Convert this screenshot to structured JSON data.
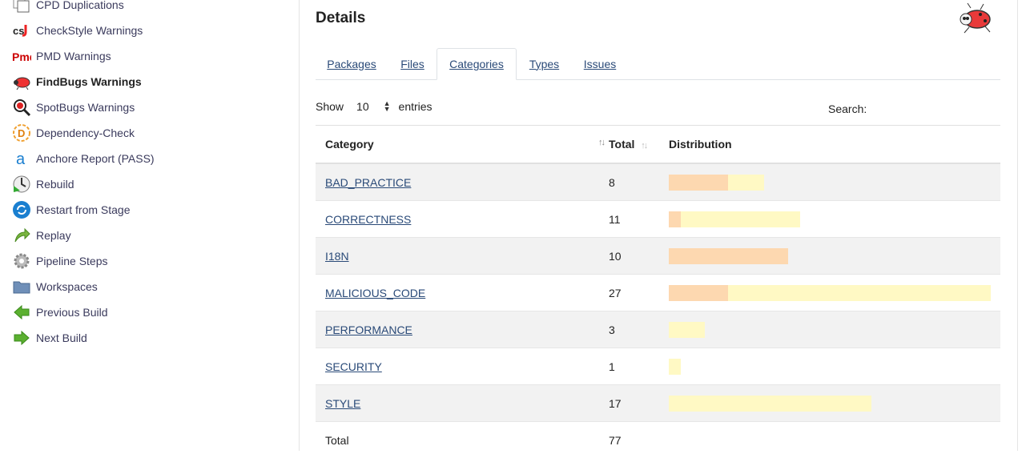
{
  "sidebar": {
    "items": [
      {
        "label": "CPD Duplications",
        "icon": "cpd-icon"
      },
      {
        "label": "CheckStyle Warnings",
        "icon": "checkstyle-icon"
      },
      {
        "label": "PMD Warnings",
        "icon": "pmd-icon"
      },
      {
        "label": "FindBugs Warnings",
        "icon": "findbugs-icon",
        "active": true
      },
      {
        "label": "SpotBugs Warnings",
        "icon": "spotbugs-icon"
      },
      {
        "label": "Dependency-Check",
        "icon": "dependency-check-icon"
      },
      {
        "label": "Anchore Report (PASS)",
        "icon": "anchore-icon"
      },
      {
        "label": "Rebuild",
        "icon": "rebuild-icon"
      },
      {
        "label": "Restart from Stage",
        "icon": "restart-icon"
      },
      {
        "label": "Replay",
        "icon": "replay-icon"
      },
      {
        "label": "Pipeline Steps",
        "icon": "gear-icon"
      },
      {
        "label": "Workspaces",
        "icon": "folder-icon"
      },
      {
        "label": "Previous Build",
        "icon": "arrow-left-icon"
      },
      {
        "label": "Next Build",
        "icon": "arrow-right-icon"
      }
    ]
  },
  "main": {
    "title": "Details",
    "tabs": [
      "Packages",
      "Files",
      "Categories",
      "Types",
      "Issues"
    ],
    "active_tab": "Categories",
    "show_label": "Show",
    "entries_value": "10",
    "entries_label": "entries",
    "search_label": "Search:",
    "table": {
      "headers": {
        "category": "Category",
        "total": "Total",
        "distribution": "Distribution"
      },
      "rows": [
        {
          "category": "BAD_PRACTICE",
          "total": "8",
          "dist": [
            5,
            3
          ]
        },
        {
          "category": "CORRECTNESS",
          "total": "11",
          "dist": [
            1,
            10
          ]
        },
        {
          "category": "I18N",
          "total": "10",
          "dist": [
            10,
            0
          ]
        },
        {
          "category": "MALICIOUS_CODE",
          "total": "27",
          "dist": [
            5,
            22
          ]
        },
        {
          "category": "PERFORMANCE",
          "total": "3",
          "dist": [
            0,
            3
          ]
        },
        {
          "category": "SECURITY",
          "total": "1",
          "dist": [
            0,
            1
          ]
        },
        {
          "category": "STYLE",
          "total": "17",
          "dist": [
            0,
            17
          ]
        }
      ],
      "footer": {
        "label": "Total",
        "total": "77"
      }
    }
  },
  "colors": {
    "severity_high": "#fdd8b0",
    "severity_normal": "#fff9c4",
    "link": "#2a4a78"
  }
}
